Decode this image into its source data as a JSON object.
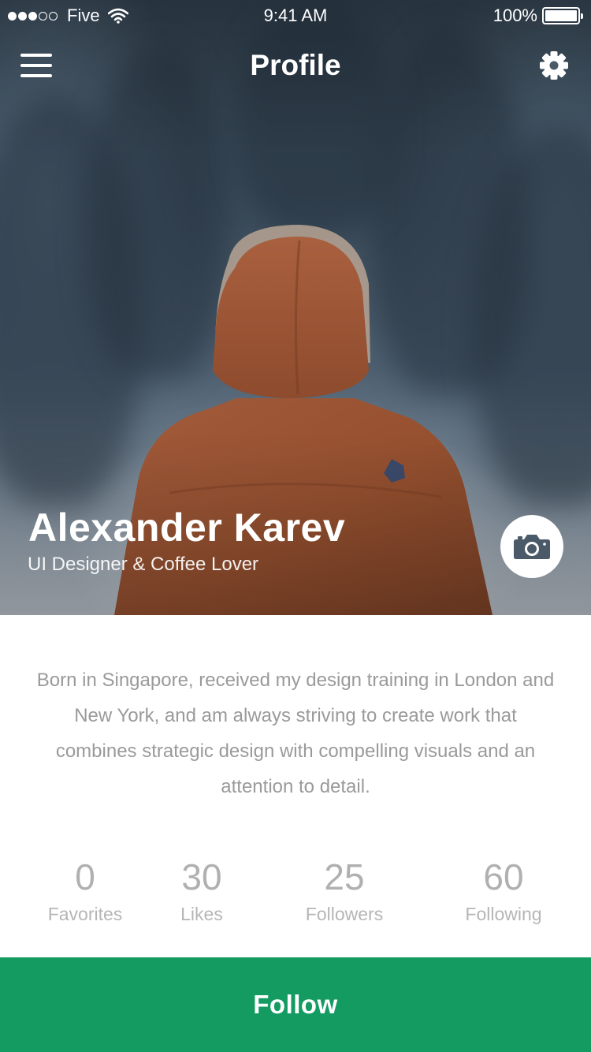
{
  "status_bar": {
    "signal_bars_filled": 3,
    "signal_bars_total": 5,
    "carrier": "Five",
    "time": "9:41 AM",
    "battery": "100%"
  },
  "nav": {
    "title": "Profile",
    "menu_icon": "hamburger-menu-icon",
    "settings_icon": "gear-icon"
  },
  "profile": {
    "name": "Alexander Karev",
    "tagline": "UI Designer & Coffee Lover",
    "camera_icon": "camera-icon",
    "bio": "Born in Singapore, received my design training in London and New York, and am always striving to create work that combines strategic design with compelling visuals and an attention to detail."
  },
  "stats": [
    {
      "value": "0",
      "label": "Favorites"
    },
    {
      "value": "30",
      "label": "Likes"
    },
    {
      "value": "25",
      "label": "Followers"
    },
    {
      "value": "60",
      "label": "Following"
    }
  ],
  "follow_button": {
    "label": "Follow",
    "color": "#139b62"
  }
}
